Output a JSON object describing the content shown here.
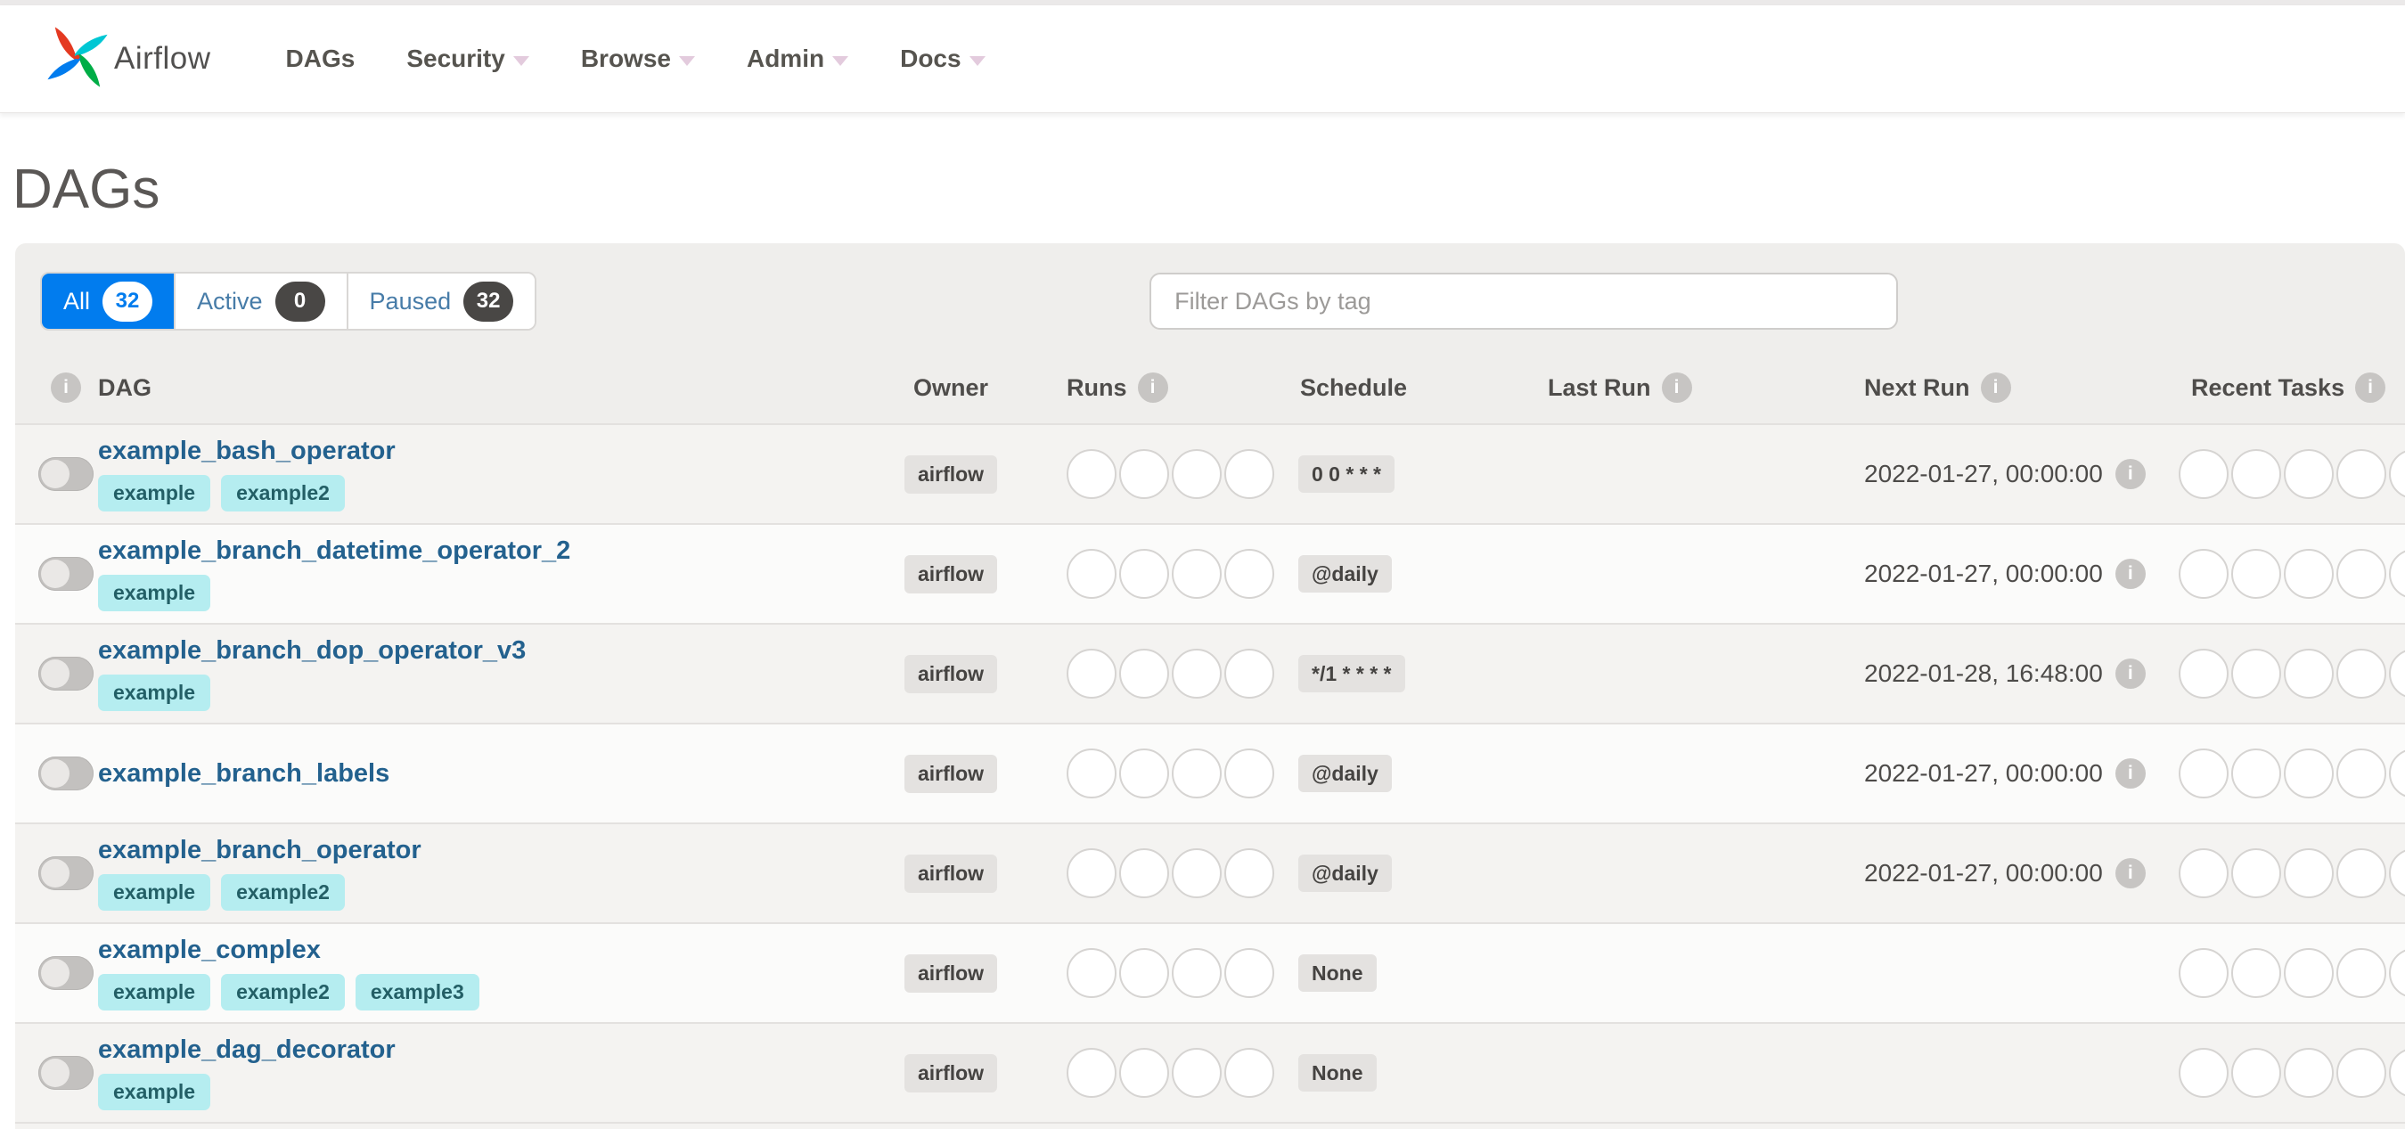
{
  "navbar": {
    "brand": "Airflow",
    "items": [
      {
        "label": "DAGs",
        "caret": false
      },
      {
        "label": "Security",
        "caret": true
      },
      {
        "label": "Browse",
        "caret": true
      },
      {
        "label": "Admin",
        "caret": true
      },
      {
        "label": "Docs",
        "caret": true
      }
    ]
  },
  "page": {
    "title": "DAGs"
  },
  "filters": {
    "tabs": [
      {
        "label": "All",
        "count": "32",
        "active": true
      },
      {
        "label": "Active",
        "count": "0",
        "active": false
      },
      {
        "label": "Paused",
        "count": "32",
        "active": false
      }
    ],
    "tag_placeholder": "Filter DAGs by tag"
  },
  "table": {
    "headers": [
      {
        "label": "DAG",
        "info": false
      },
      {
        "label": "Owner",
        "info": false
      },
      {
        "label": "Runs",
        "info": true
      },
      {
        "label": "Schedule",
        "info": false
      },
      {
        "label": "Last Run",
        "info": true
      },
      {
        "label": "Next Run",
        "info": true
      },
      {
        "label": "Recent Tasks",
        "info": true
      }
    ],
    "toggle_state": "off",
    "rows": [
      {
        "name": "example_bash_operator",
        "tags": [
          "example",
          "example2"
        ],
        "owner": "airflow",
        "runs": 4,
        "schedule": "0 0 * * *",
        "last_run": "",
        "next_run": "2022-01-27, 00:00:00",
        "recent_tasks": 5
      },
      {
        "name": "example_branch_datetime_operator_2",
        "tags": [
          "example"
        ],
        "owner": "airflow",
        "runs": 4,
        "schedule": "@daily",
        "last_run": "",
        "next_run": "2022-01-27, 00:00:00",
        "recent_tasks": 5
      },
      {
        "name": "example_branch_dop_operator_v3",
        "tags": [
          "example"
        ],
        "owner": "airflow",
        "runs": 4,
        "schedule": "*/1 * * * *",
        "last_run": "",
        "next_run": "2022-01-28, 16:48:00",
        "recent_tasks": 5
      },
      {
        "name": "example_branch_labels",
        "tags": [],
        "owner": "airflow",
        "runs": 4,
        "schedule": "@daily",
        "last_run": "",
        "next_run": "2022-01-27, 00:00:00",
        "recent_tasks": 5
      },
      {
        "name": "example_branch_operator",
        "tags": [
          "example",
          "example2"
        ],
        "owner": "airflow",
        "runs": 4,
        "schedule": "@daily",
        "last_run": "",
        "next_run": "2022-01-27, 00:00:00",
        "recent_tasks": 5
      },
      {
        "name": "example_complex",
        "tags": [
          "example",
          "example2",
          "example3"
        ],
        "owner": "airflow",
        "runs": 4,
        "schedule": "None",
        "last_run": "",
        "next_run": "",
        "recent_tasks": 5
      },
      {
        "name": "example_dag_decorator",
        "tags": [
          "example"
        ],
        "owner": "airflow",
        "runs": 4,
        "schedule": "None",
        "last_run": "",
        "next_run": "",
        "recent_tasks": 5
      }
    ]
  },
  "colors": {
    "accent_blue": "#017cee",
    "dag_link_blue": "#23618e",
    "tag_bg": "#b5edf0",
    "tag_text": "#235f66",
    "gray_badge_bg": "#e4e2e0",
    "dark_badge_bg": "#494745",
    "logo_red": "#e43921",
    "logo_cyan": "#00c7d4",
    "logo_green": "#00ad46",
    "logo_blue": "#017cee"
  }
}
